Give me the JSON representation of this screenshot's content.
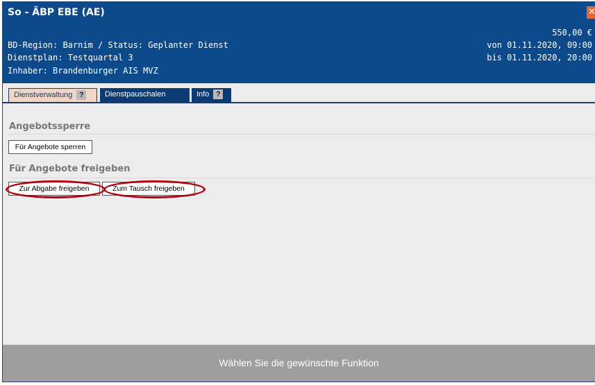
{
  "header": {
    "title": "So - ÄBP EBE (AE)",
    "price": "550,00 €",
    "region_status": "BD-Region: Barnim / Status: Geplanter Dienst",
    "from": "von 01.11.2020, 09:00",
    "plan": "Dienstplan: Testquartal 3",
    "until": "bis 01.11.2020, 20:00",
    "owner": "Inhaber: Brandenburger AIS MVZ",
    "close_icon": "close-icon",
    "colors": {
      "header_bg": "#0c4a8c",
      "close_bg": "#e0673a"
    }
  },
  "tabs": [
    {
      "label": "Dienstverwaltung",
      "active": true,
      "help": "?"
    },
    {
      "label": "Dienstpauschalen",
      "active": false
    },
    {
      "label": "Info",
      "active": false,
      "help": "?"
    }
  ],
  "sections": {
    "lock": {
      "title": "Angebotssperre",
      "button": "Für Angebote sperren"
    },
    "release": {
      "title": "Für Angebote freigeben",
      "button_abgabe": "Zur Abgabe freigeben",
      "button_tausch": "Zum Tausch freigeben"
    }
  },
  "footer": {
    "text": "Wählen Sie die gewünschte Funktion"
  },
  "annotation_color": "#b2000f"
}
